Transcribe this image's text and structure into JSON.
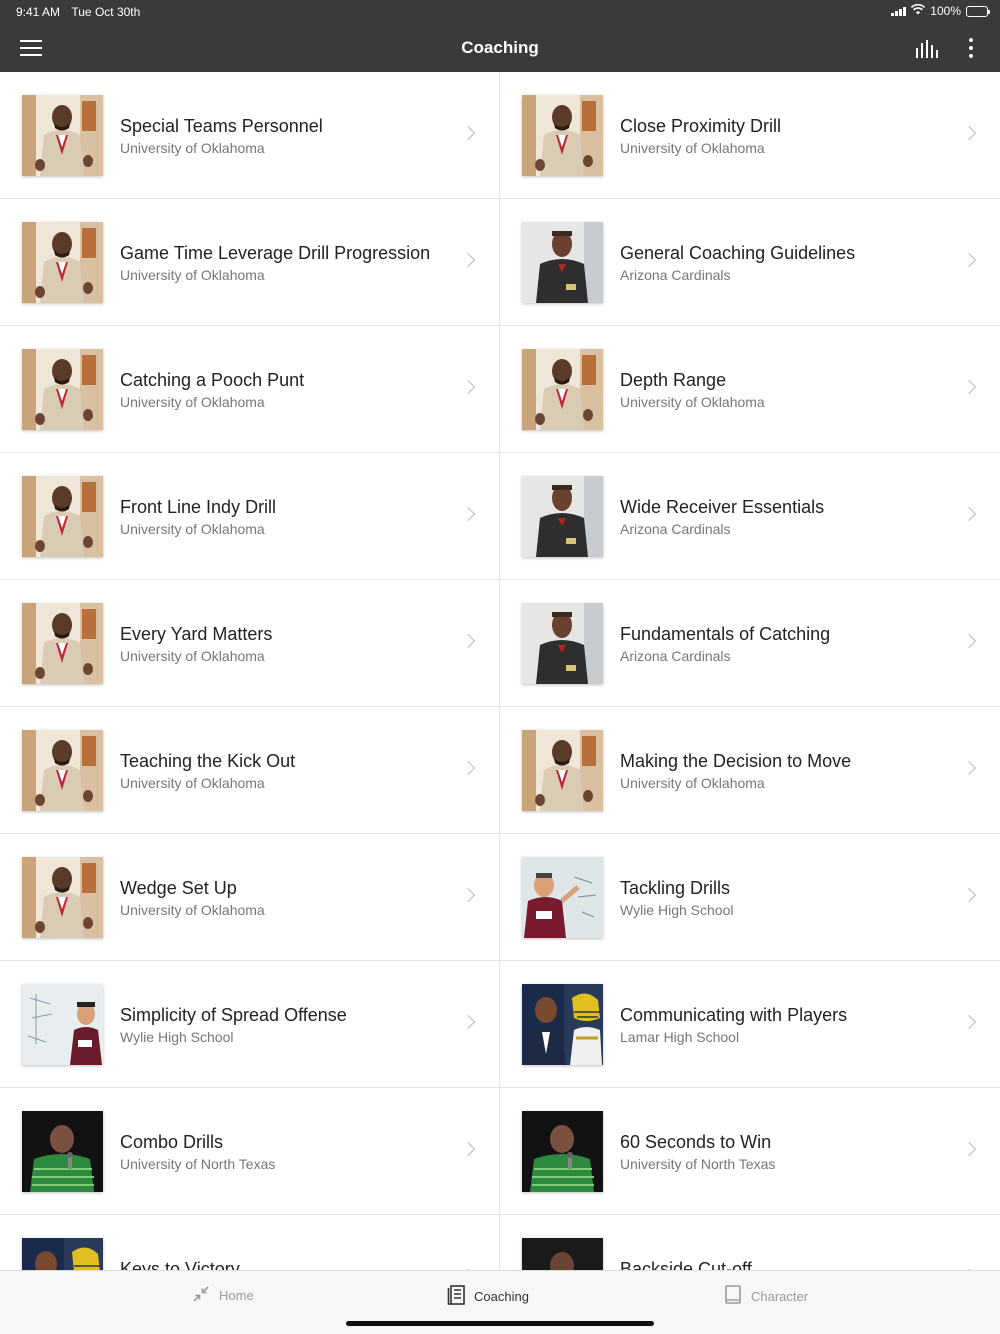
{
  "status_bar": {
    "time": "9:41 AM",
    "date": "Tue Oct 30th",
    "battery": "100%"
  },
  "header": {
    "title": "Coaching"
  },
  "colors": {
    "nav_background": "#3a3a3c",
    "divider": "#e4e4e4",
    "chevron": "#b8b8b8",
    "subtitle": "#777777"
  },
  "lessons": [
    {
      "title": "Special Teams Personnel",
      "school": "University of Oklahoma",
      "thumb": "oklahoma-coach"
    },
    {
      "title": "Close Proximity Drill",
      "school": "University of Oklahoma",
      "thumb": "oklahoma-coach"
    },
    {
      "title": "Game Time Leverage Drill Progression",
      "school": "University of Oklahoma",
      "thumb": "oklahoma-coach"
    },
    {
      "title": "General Coaching Guidelines",
      "school": "Arizona Cardinals",
      "thumb": "cardinals-coach"
    },
    {
      "title": "Catching a Pooch Punt",
      "school": "University of Oklahoma",
      "thumb": "oklahoma-coach"
    },
    {
      "title": "Depth Range",
      "school": "University of Oklahoma",
      "thumb": "oklahoma-coach"
    },
    {
      "title": "Front Line Indy Drill",
      "school": "University of Oklahoma",
      "thumb": "oklahoma-coach"
    },
    {
      "title": "Wide Receiver Essentials",
      "school": "Arizona Cardinals",
      "thumb": "cardinals-coach"
    },
    {
      "title": "Every Yard Matters",
      "school": "University of Oklahoma",
      "thumb": "oklahoma-coach"
    },
    {
      "title": "Fundamentals of Catching",
      "school": "Arizona Cardinals",
      "thumb": "cardinals-coach"
    },
    {
      "title": "Teaching the Kick Out",
      "school": "University of Oklahoma",
      "thumb": "oklahoma-coach"
    },
    {
      "title": "Making the Decision to Move",
      "school": "University of Oklahoma",
      "thumb": "oklahoma-coach"
    },
    {
      "title": "Wedge Set Up",
      "school": "University of Oklahoma",
      "thumb": "oklahoma-coach"
    },
    {
      "title": "Tackling Drills",
      "school": "Wylie High School",
      "thumb": "wylie-whiteboard"
    },
    {
      "title": "Simplicity of Spread Offense",
      "school": "Wylie High School",
      "thumb": "wylie-whiteboard-2"
    },
    {
      "title": "Communicating with Players",
      "school": "Lamar High School",
      "thumb": "lamar-players"
    },
    {
      "title": "Combo Drills",
      "school": "University of North Texas",
      "thumb": "north-texas-coach"
    },
    {
      "title": "60 Seconds to Win",
      "school": "University of North Texas",
      "thumb": "north-texas-coach"
    },
    {
      "title": "Keys to Victory",
      "school": "",
      "thumb": "lamar-players"
    },
    {
      "title": "Backside Cut-off",
      "school": "",
      "thumb": "dark-coach"
    }
  ],
  "tabs": [
    {
      "label": "Home",
      "icon": "collapse-arrows-icon",
      "active": false
    },
    {
      "label": "Coaching",
      "icon": "notebook-icon",
      "active": true
    },
    {
      "label": "Character",
      "icon": "book-icon",
      "active": false
    }
  ]
}
